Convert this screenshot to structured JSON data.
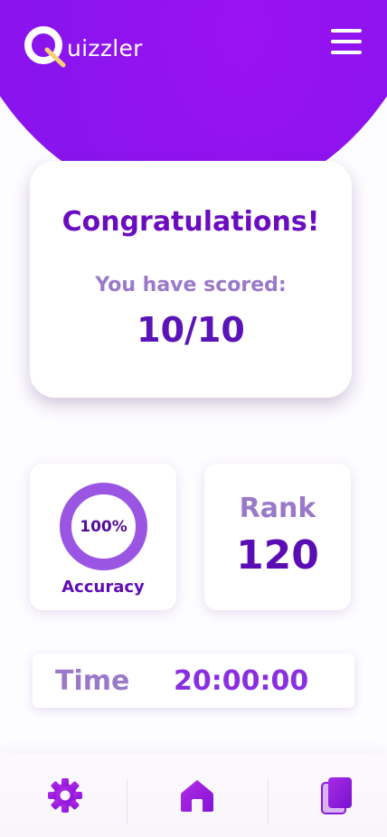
{
  "app": {
    "title": "Quizzler",
    "logo_letter": "Q",
    "logo_rest": "uizzler"
  },
  "header": {
    "menu_icon": "hamburger-menu-icon"
  },
  "score_card": {
    "title": "Congratulations!",
    "scored_label": "You have scored:",
    "score": "10/10"
  },
  "accuracy": {
    "value": "100%",
    "fraction": 1.0,
    "label": "Accuracy"
  },
  "rank": {
    "label": "Rank",
    "value": "120"
  },
  "time": {
    "label": "Time",
    "value": "20:00:00"
  },
  "bottom_nav": {
    "items": [
      {
        "name": "settings",
        "icon": "gear-icon"
      },
      {
        "name": "home",
        "icon": "home-icon"
      },
      {
        "name": "cards",
        "icon": "cards-icon"
      }
    ]
  },
  "colors": {
    "brand_purple": "#8f10f0",
    "dark_purple": "#5a14b8",
    "muted_purple": "#9a79c9",
    "ring_purple": "#9a56e2"
  }
}
